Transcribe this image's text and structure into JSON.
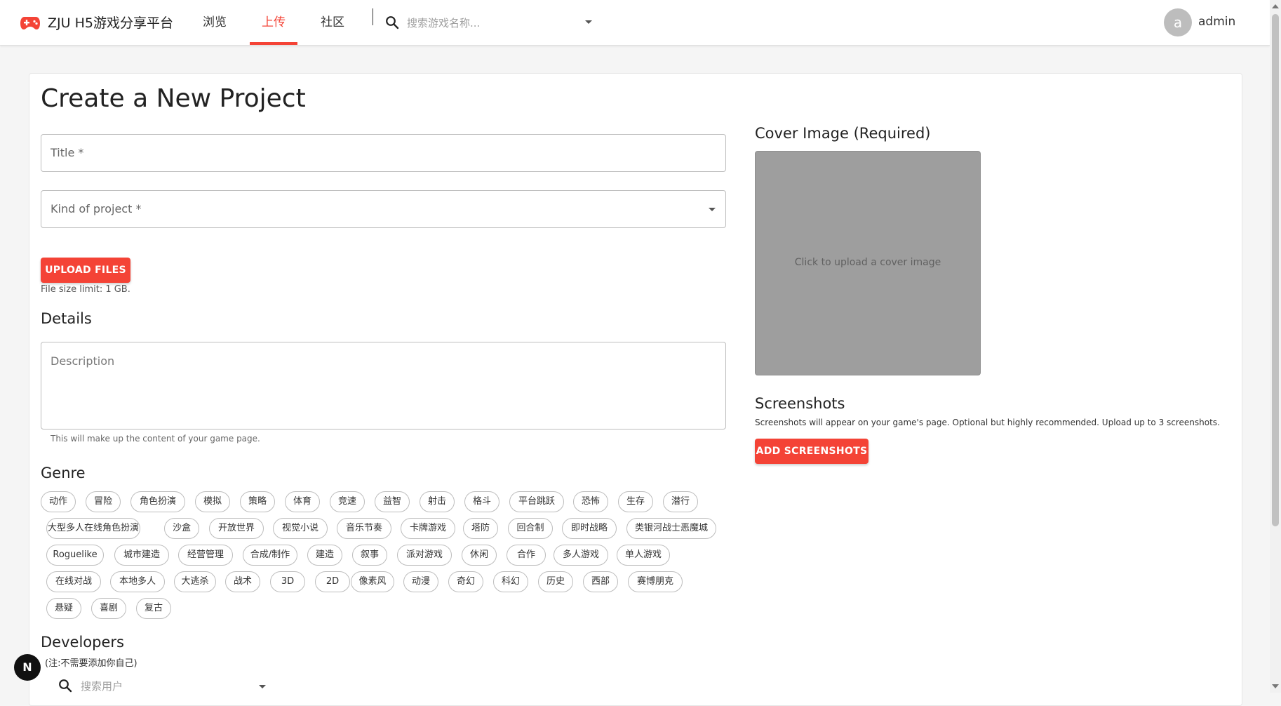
{
  "header": {
    "brand": "ZJU H5游戏分享平台",
    "logo_icon": "gamepad-icon",
    "nav": [
      {
        "label": "浏览",
        "active": false
      },
      {
        "label": "上传",
        "active": true
      },
      {
        "label": "社区",
        "active": false
      }
    ],
    "search_placeholder": "搜索游戏名称...",
    "avatar_letter": "a",
    "username": "admin",
    "accent_color": "#f44336"
  },
  "form": {
    "page_title": "Create a New Project",
    "title_label": "Title *",
    "kind_label": "Kind of project *",
    "upload_button": "UPLOAD FILES",
    "file_limit": "File size limit: 1 GB.",
    "details_heading": "Details",
    "description_placeholder": "Description",
    "description_helper": "This will make up the content of your game page.",
    "genre_heading": "Genre",
    "genres": [
      "动作",
      "冒险",
      "角色扮演",
      "模拟",
      "策略",
      "体育",
      "竞速",
      "益智",
      "射击",
      "格斗",
      "平台跳跃",
      "恐怖",
      "生存",
      "潜行",
      "大型多人在线角色扮演",
      "沙盒",
      "开放世界",
      "视觉小说",
      "音乐节奏",
      "卡牌游戏",
      "塔防",
      "回合制",
      "即时战略",
      "类银河战士恶魔城",
      "Roguelike",
      "城市建造",
      "经营管理",
      "合成/制作",
      "建造",
      "叙事",
      "派对游戏",
      "休闲",
      "合作",
      "多人游戏",
      "单人游戏",
      "在线对战",
      "本地多人",
      "大逃杀",
      "战术",
      "3D",
      "2D",
      "像素风",
      "动漫",
      "奇幻",
      "科幻",
      "历史",
      "西部",
      "赛博朋克",
      "悬疑",
      "喜剧",
      "复古"
    ],
    "developers_heading": "Developers",
    "developers_note": "(注:不需要添加你自己)",
    "developer_search_placeholder": "搜索用户"
  },
  "media": {
    "cover_heading": "Cover Image (Required)",
    "cover_text": "Click to upload a cover image",
    "screenshots_heading": "Screenshots",
    "screenshots_help": "Screenshots will appear on your game's page. Optional but highly recommended. Upload up to 3 screenshots.",
    "add_screenshots_button": "ADD SCREENSHOTS"
  },
  "badge": {
    "letter": "N"
  }
}
